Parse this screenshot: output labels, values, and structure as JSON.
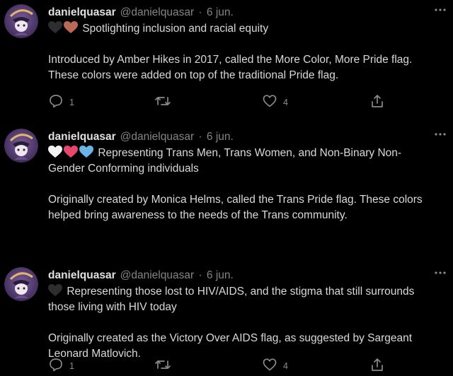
{
  "tweets": [
    {
      "name": "danielquasar",
      "handle": "@danielquasar",
      "separator": "·",
      "date": "6 jun.",
      "emojis": [
        "black-heart",
        "brown-heart"
      ],
      "lines": [
        "Spotlighting inclusion and racial equity",
        "",
        "Introduced by Amber Hikes in 2017, called the More Color, More Pride flag.",
        "These colors were added on top of the traditional Pride flag."
      ],
      "reply_count": "1",
      "retweet_count": "",
      "like_count": "4"
    },
    {
      "name": "danielquasar",
      "handle": "@danielquasar",
      "separator": "·",
      "date": "6 jun.",
      "emojis": [
        "white-heart",
        "pink-heart",
        "light-blue-heart"
      ],
      "lines": [
        "Representing Trans Men, Trans Women, and Non-Binary Non-",
        "Gender Conforming individuals",
        "",
        "Originally created by Monica Helms, called the Trans Pride flag. These colors",
        "helped bring awareness to the needs of the Trans community."
      ],
      "reply_count": "1",
      "retweet_count": "",
      "like_count": "4"
    },
    {
      "name": "danielquasar",
      "handle": "@danielquasar",
      "separator": "·",
      "date": "6 jun.",
      "emojis": [
        "black-heart"
      ],
      "lines": [
        "Representing those lost to HIV/AIDS, and the stigma that still surrounds",
        "those living with HIV today",
        "",
        "Originally created as the Victory Over AIDS flag, as suggested by Sargeant",
        "Leonard Matlovich."
      ]
    }
  ],
  "colors": {
    "background": "#000000",
    "black_heart": "#2e2e30",
    "brown_heart": "#b86a56",
    "white_heart": "#f2f2f2",
    "pink_heart": "#e8476c",
    "light_blue_heart": "#6cb4e8"
  }
}
